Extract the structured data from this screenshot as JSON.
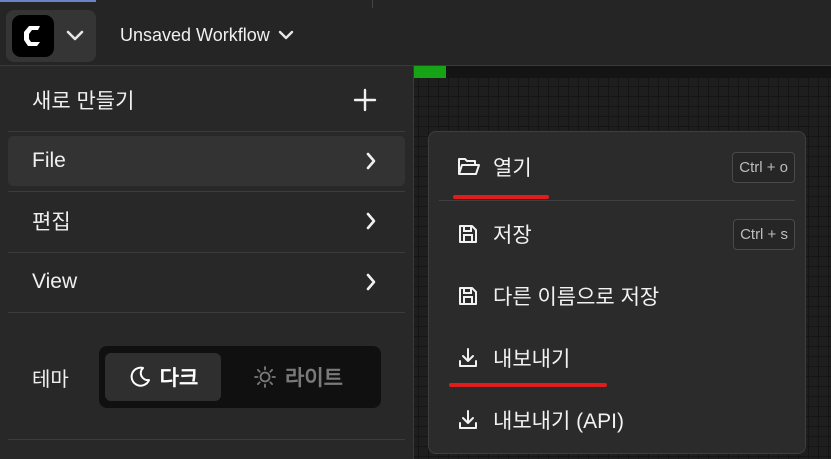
{
  "header": {
    "workflow_title": "Unsaved Workflow"
  },
  "canvas": {
    "progress_fraction": 0.09,
    "progress_color": "#16a316"
  },
  "main_menu": {
    "items": [
      {
        "label": "새로 만들기",
        "trail": "plus-icon"
      },
      {
        "label": "File",
        "trail": "chevron-right-icon",
        "active": true
      },
      {
        "label": "편집",
        "trail": "chevron-right-icon"
      },
      {
        "label": "View",
        "trail": "chevron-right-icon"
      }
    ],
    "theme": {
      "label": "테마",
      "dark_label": "다크",
      "light_label": "라이트",
      "selected": "dark"
    }
  },
  "file_submenu": {
    "items": [
      {
        "label": "열기",
        "icon": "folder-open-icon",
        "shortcut": "Ctrl + o",
        "underlined": true
      },
      {
        "label": "저장",
        "icon": "save-icon",
        "shortcut": "Ctrl + s"
      },
      {
        "label": "다른 이름으로 저장",
        "icon": "save-icon",
        "shortcut": ""
      },
      {
        "label": "내보내기",
        "icon": "download-icon",
        "shortcut": "",
        "underlined": true
      },
      {
        "label": "내보내기 (API)",
        "icon": "download-icon",
        "shortcut": ""
      }
    ]
  },
  "colors": {
    "accent_underline": "#e01c1c",
    "menu_bg": "#282828",
    "submenu_bg": "#2b2b2b"
  }
}
